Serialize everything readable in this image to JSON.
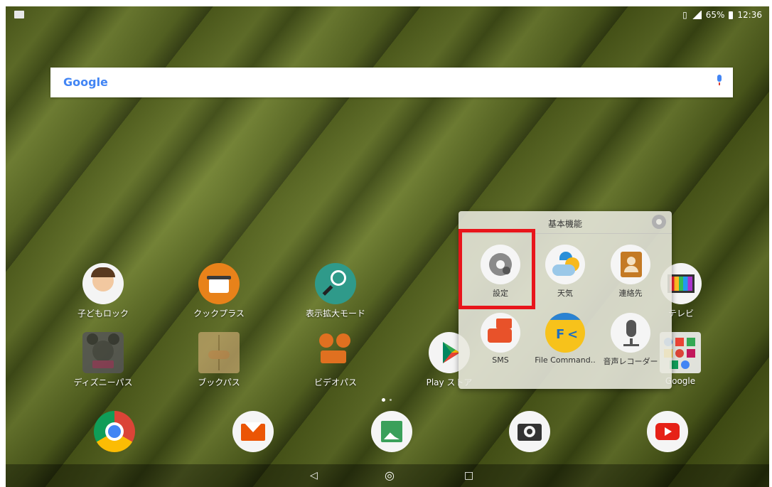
{
  "status_bar": {
    "battery": "65%",
    "time": "12:36"
  },
  "search": {
    "logo": "Google"
  },
  "home_apps": [
    {
      "label": "子どもロック",
      "icon": "kid-lock-icon"
    },
    {
      "label": "クックプラス",
      "icon": "cook-plus-icon"
    },
    {
      "label": "表示拡大モード",
      "icon": "zoom-mode-icon"
    },
    {
      "label": "テレビ",
      "icon": "tv-icon"
    },
    {
      "label": "ディズニーパス",
      "icon": "disney-pass-icon"
    },
    {
      "label": "ブックパス",
      "icon": "book-pass-icon"
    },
    {
      "label": "ビデオパス",
      "icon": "video-pass-icon"
    },
    {
      "label": "Play ストア",
      "icon": "play-store-icon"
    },
    {
      "label": "Google",
      "icon": "google-folder-icon"
    }
  ],
  "folder": {
    "title": "基本機能",
    "apps": [
      {
        "label": "設定",
        "icon": "settings-icon"
      },
      {
        "label": "天気",
        "icon": "weather-icon"
      },
      {
        "label": "連絡先",
        "icon": "contacts-icon"
      },
      {
        "label": "SMS",
        "icon": "sms-icon"
      },
      {
        "label": "File Command..",
        "icon": "file-commander-icon"
      },
      {
        "label": "音声レコーダー",
        "icon": "voice-recorder-icon"
      }
    ]
  },
  "dock": [
    "chrome-icon",
    "au-mail-icon",
    "gallery-icon",
    "camera-icon",
    "youtube-icon"
  ],
  "colors": {
    "highlight": "#e8151b",
    "google_blue": "#4285f4"
  }
}
